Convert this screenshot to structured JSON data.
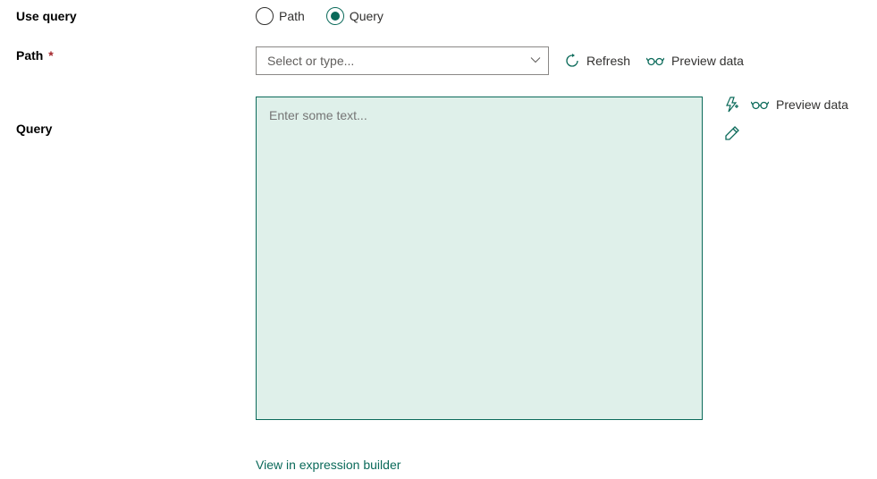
{
  "labels": {
    "use_query": "Use query",
    "path": "Path",
    "required": "*",
    "query": "Query"
  },
  "radio": {
    "path": "Path",
    "query": "Query"
  },
  "combo": {
    "placeholder": "Select or type..."
  },
  "actions": {
    "refresh": "Refresh",
    "preview_data": "Preview data"
  },
  "textarea": {
    "placeholder": "Enter some text..."
  },
  "link": {
    "expression_builder": "View in expression builder"
  }
}
